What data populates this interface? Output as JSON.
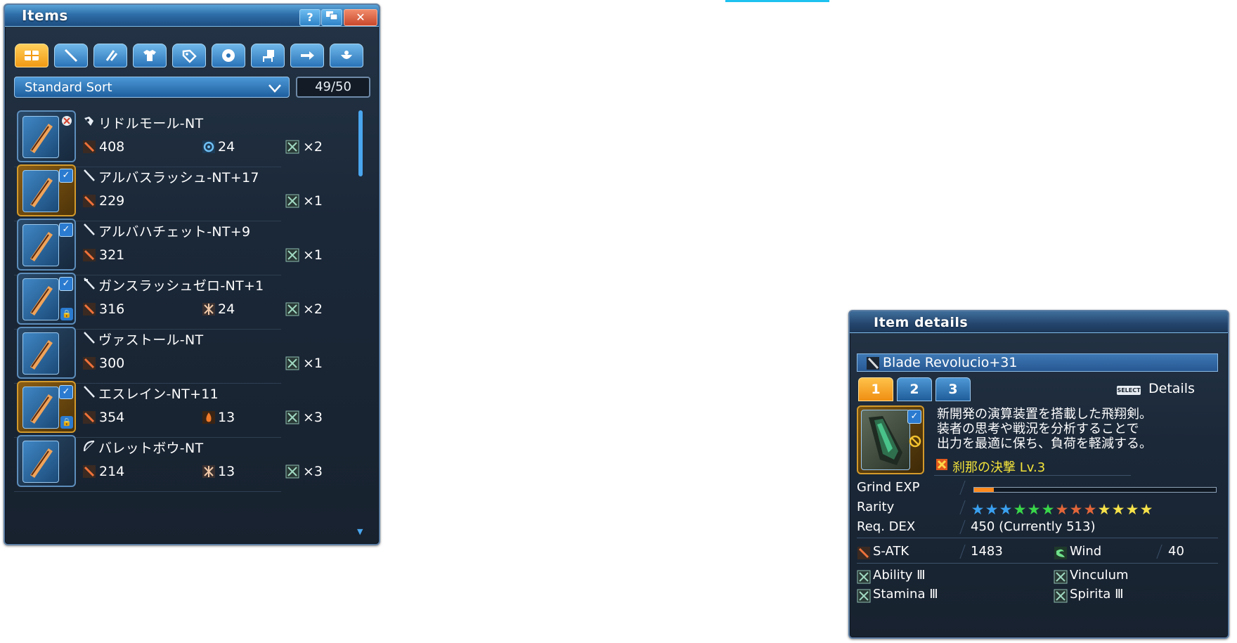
{
  "items_window": {
    "title": "Items",
    "help_label": "?",
    "close_label": "✕",
    "category_tabs": [
      {
        "icon": "all-items-icon",
        "active": true
      },
      {
        "icon": "sword-icon",
        "active": false
      },
      {
        "icon": "double-blade-icon",
        "active": false
      },
      {
        "icon": "armor-icon",
        "active": false
      },
      {
        "icon": "tag-icon",
        "active": false
      },
      {
        "icon": "disc-icon",
        "active": false
      },
      {
        "icon": "room-item-icon",
        "active": false
      },
      {
        "icon": "arrow-icon",
        "active": false
      },
      {
        "icon": "pot-icon",
        "active": false
      }
    ],
    "sort_label": "Standard Sort",
    "capacity": "49/50",
    "items": [
      {
        "name": "リドルモール-NT",
        "type_icon": "wand-icon",
        "atk": "408",
        "elem_icon": "light-element-icon",
        "elem": "24",
        "slots": "×2",
        "rare": false,
        "checked": false,
        "locked": false,
        "no_edit": true
      },
      {
        "name": "アルバスラッシュ-NT+17",
        "type_icon": "sword-icon",
        "atk": "229",
        "elem_icon": "",
        "elem": "",
        "slots": "×1",
        "rare": true,
        "checked": true,
        "locked": false,
        "no_edit": false
      },
      {
        "name": "アルバハチェット-NT+9",
        "type_icon": "sword-icon",
        "atk": "321",
        "elem_icon": "",
        "elem": "",
        "slots": "×1",
        "rare": false,
        "checked": true,
        "locked": false,
        "no_edit": false
      },
      {
        "name": "ガンスラッシュゼロ-NT+1",
        "type_icon": "gunslash-icon",
        "atk": "316",
        "elem_icon": "ice-element-icon",
        "elem": "24",
        "slots": "×2",
        "rare": false,
        "checked": true,
        "locked": true,
        "no_edit": false
      },
      {
        "name": "ヴァストール-NT",
        "type_icon": "sword-icon",
        "atk": "300",
        "elem_icon": "",
        "elem": "",
        "slots": "×1",
        "rare": false,
        "checked": false,
        "locked": false,
        "no_edit": false
      },
      {
        "name": "エスレイン-NT+11",
        "type_icon": "sword-icon",
        "atk": "354",
        "elem_icon": "fire-element-icon",
        "elem": "13",
        "slots": "×3",
        "rare": true,
        "checked": true,
        "locked": true,
        "no_edit": false
      },
      {
        "name": "バレットボウ-NT",
        "type_icon": "bow-icon",
        "atk": "214",
        "elem_icon": "ice-element-icon",
        "elem": "13",
        "slots": "×3",
        "rare": false,
        "checked": false,
        "locked": false,
        "no_edit": false
      }
    ]
  },
  "details_window": {
    "title": "Item details",
    "item_name": "Blade Revolucio+31",
    "page_tabs": [
      "1",
      "2",
      "3"
    ],
    "active_page": "1",
    "select_badge": "SELECT",
    "details_label": "Details",
    "description_lines": [
      "新開発の演算装置を搭載した飛翔剣。",
      "装者の思考や戦況を分析することで",
      "出力を最適に保ち、負荷を軽減する。"
    ],
    "potential": "刹那の決撃 Lv.3",
    "grind_exp_label": "Grind EXP",
    "grind_exp_fraction": 0.08,
    "rarity_label": "Rarity",
    "rarity_stars": 13,
    "rarity_colors": [
      "#3aa0f0",
      "#3aa0f0",
      "#3aa0f0",
      "#39d64a",
      "#39d64a",
      "#39d64a",
      "#e2663a",
      "#e2663a",
      "#e2663a",
      "#f6e24a",
      "#f6e24a",
      "#f6e24a",
      "#f6e24a"
    ],
    "req_label": "Req. DEX",
    "req_value": "450 (Currently 513)",
    "satk_label": "S-ATK",
    "satk_value": "1483",
    "element_label": "Wind",
    "element_value": "40",
    "abilities": [
      "Ability Ⅲ",
      "Vinculum",
      "Stamina Ⅲ",
      "Spirita Ⅲ"
    ]
  }
}
